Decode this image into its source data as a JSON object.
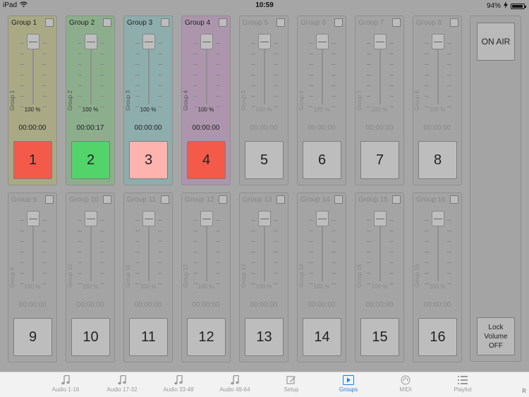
{
  "status_bar": {
    "device": "iPad",
    "time": "10:59",
    "battery_percent": 94,
    "battery_label": "94%"
  },
  "groups": [
    {
      "name": "Group 1",
      "side_label": "Group 1",
      "volume": "100 %",
      "time": "00:00:00",
      "button": "1",
      "state": "playing",
      "color": "#f35a4a"
    },
    {
      "name": "Group 2",
      "side_label": "Group 2",
      "volume": "100 %",
      "time": "00:00:17",
      "button": "2",
      "state": "playing",
      "color": "#52d46a"
    },
    {
      "name": "Group 3",
      "side_label": "Group 3",
      "volume": "100 %",
      "time": "00:00:00",
      "button": "3",
      "state": "cued",
      "color": "#ffb3ae"
    },
    {
      "name": "Group 4",
      "side_label": "Group 4",
      "volume": "100 %",
      "time": "00:00:00",
      "button": "4",
      "state": "playing",
      "color": "#f35a4a"
    },
    {
      "name": "Group 5",
      "side_label": "Group 5",
      "volume": "100 %",
      "time": "00:00:00",
      "button": "5",
      "state": "idle",
      "color": "#bdbdbd"
    },
    {
      "name": "Group 6",
      "side_label": "Group 6",
      "volume": "100 %",
      "time": "00:00:00",
      "button": "6",
      "state": "idle",
      "color": "#bdbdbd"
    },
    {
      "name": "Group 7",
      "side_label": "Group 7",
      "volume": "100 %",
      "time": "00:00:00",
      "button": "7",
      "state": "idle",
      "color": "#bdbdbd"
    },
    {
      "name": "Group 8",
      "side_label": "Group 8",
      "volume": "100 %",
      "time": "00:00:00",
      "button": "8",
      "state": "idle",
      "color": "#bdbdbd"
    },
    {
      "name": "Group 9",
      "side_label": "Group 9",
      "volume": "100 %",
      "time": "00:00:00",
      "button": "9",
      "state": "idle",
      "color": "#bdbdbd"
    },
    {
      "name": "Group 10",
      "side_label": "Group 10",
      "volume": "100 %",
      "time": "00:00:00",
      "button": "10",
      "state": "idle",
      "color": "#bdbdbd"
    },
    {
      "name": "Group 11",
      "side_label": "Group 11",
      "volume": "100 %",
      "time": "00:00:00",
      "button": "11",
      "state": "idle",
      "color": "#bdbdbd"
    },
    {
      "name": "Group 12",
      "side_label": "Group 12",
      "volume": "100 %",
      "time": "00:00:00",
      "button": "12",
      "state": "idle",
      "color": "#bdbdbd"
    },
    {
      "name": "Group 13",
      "side_label": "Group 13",
      "volume": "100 %",
      "time": "00:00:00",
      "button": "13",
      "state": "idle",
      "color": "#bdbdbd"
    },
    {
      "name": "Group 14",
      "side_label": "Group 14",
      "volume": "100 %",
      "time": "00:00:00",
      "button": "14",
      "state": "idle",
      "color": "#bdbdbd"
    },
    {
      "name": "Group 15",
      "side_label": "Group 15",
      "volume": "100 %",
      "time": "00:00:00",
      "button": "15",
      "state": "idle",
      "color": "#bdbdbd"
    },
    {
      "name": "Group 16",
      "side_label": "Group 16",
      "volume": "100 %",
      "time": "00:00:00",
      "button": "16",
      "state": "idle",
      "color": "#bdbdbd"
    }
  ],
  "side_panel": {
    "on_air_label": "ON AIR",
    "lock_label": "Lock\nVolume\nOFF"
  },
  "tabs": [
    {
      "label": "Audio 1-16",
      "icon": "music-note-icon",
      "active": false
    },
    {
      "label": "Audio 17-32",
      "icon": "music-note-icon",
      "active": false
    },
    {
      "label": "Audio 33-48",
      "icon": "music-note-icon",
      "active": false
    },
    {
      "label": "Audio 49-64",
      "icon": "music-note-icon",
      "active": false
    },
    {
      "label": "Setup",
      "icon": "edit-icon",
      "active": false
    },
    {
      "label": "Groups",
      "icon": "play-icon",
      "active": true
    },
    {
      "label": "MIDI",
      "icon": "midi-icon",
      "active": false
    },
    {
      "label": "Playlist",
      "icon": "list-icon",
      "active": false
    }
  ],
  "tab_bar_corner": "R",
  "colors": {
    "accent": "#1f7fe0",
    "playing": "#f35a4a",
    "playing_green": "#52d46a",
    "cued": "#ffb3ae"
  }
}
